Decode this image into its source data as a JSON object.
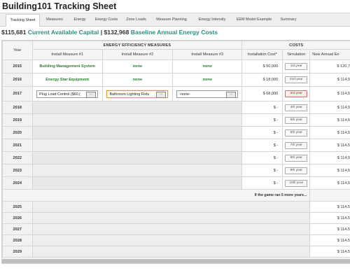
{
  "app": {
    "title": "Building101 Tracking Sheet"
  },
  "tabs": [
    {
      "label": "Tracking Sheet",
      "active": true
    },
    {
      "label": "Measures"
    },
    {
      "label": "Energy"
    },
    {
      "label": "Energy Costs"
    },
    {
      "label": "Zone Loads"
    },
    {
      "label": "Measure Planning"
    },
    {
      "label": "Energy Intensity"
    },
    {
      "label": "EEM Model Example"
    },
    {
      "label": "Summary"
    }
  ],
  "summary": {
    "capital_value": "$115,681",
    "capital_label": "Current Available Capital",
    "separator": " | ",
    "baseline_value": "$132,968",
    "baseline_label": "Baseline Annual Energy Costs"
  },
  "table": {
    "year_header": "Year",
    "group_measures": "ENERGY EFFICIENCY MEASURES",
    "group_costs": "COSTS",
    "col_m1": "Install Measure #1",
    "col_m2": "Install Measure #2",
    "col_m3": "Install Measure #3",
    "col_install_cost": "Installation Cost*",
    "col_simulation": "Simulation",
    "col_energy": "New Annual En",
    "rows": [
      {
        "year": "2015",
        "m1": "Building Management System",
        "m2": "none",
        "m3": "none",
        "cost": "$ 50,000",
        "sim": "1st year",
        "energy": "$ 120,7"
      },
      {
        "year": "2016",
        "m1": "Energy Star Equipment",
        "m2": "none",
        "m3": "none",
        "cost": "$ 18,000",
        "sim": "2nd year",
        "energy": "$ 114,5"
      },
      {
        "year": "2017",
        "m1": "Plug Load Control ($60,(",
        "m2": "Bathroom Lighting Fixtu",
        "m3": "-none-",
        "cost": "$ 68,000",
        "sim": "3rd year",
        "energy": "$ 114,5"
      },
      {
        "year": "2018",
        "cost": "$ -",
        "sim": "4th year",
        "energy": "$ 114,5"
      },
      {
        "year": "2019",
        "cost": "$ -",
        "sim": "5th year",
        "energy": "$ 114,5"
      },
      {
        "year": "2020",
        "cost": "$ -",
        "sim": "6th year",
        "energy": "$ 114,5"
      },
      {
        "year": "2021",
        "cost": "$ -",
        "sim": "7th year",
        "energy": "$ 114,5"
      },
      {
        "year": "2022",
        "cost": "$ -",
        "sim": "8th year",
        "energy": "$ 114,5"
      },
      {
        "year": "2023",
        "cost": "$ -",
        "sim": "9th year",
        "energy": "$ 114,5"
      },
      {
        "year": "2024",
        "cost": "$ -",
        "sim": "10th year",
        "energy": "$ 114,5"
      }
    ],
    "future_note": "If the game ran 5 more years...",
    "future_rows": [
      {
        "year": "2025",
        "energy": "$ 114,5"
      },
      {
        "year": "2026",
        "energy": "$ 114,5"
      },
      {
        "year": "2027",
        "energy": "$ 114,5"
      },
      {
        "year": "2028",
        "energy": "$ 114,5"
      },
      {
        "year": "2029",
        "energy": "$ 114,5"
      }
    ],
    "dropdown_button": "...",
    "colors": {
      "green_text": "#2e7d32",
      "teal": "#2e8b84",
      "selected_border": "#e09a2e",
      "red_button": "#d02020"
    }
  }
}
